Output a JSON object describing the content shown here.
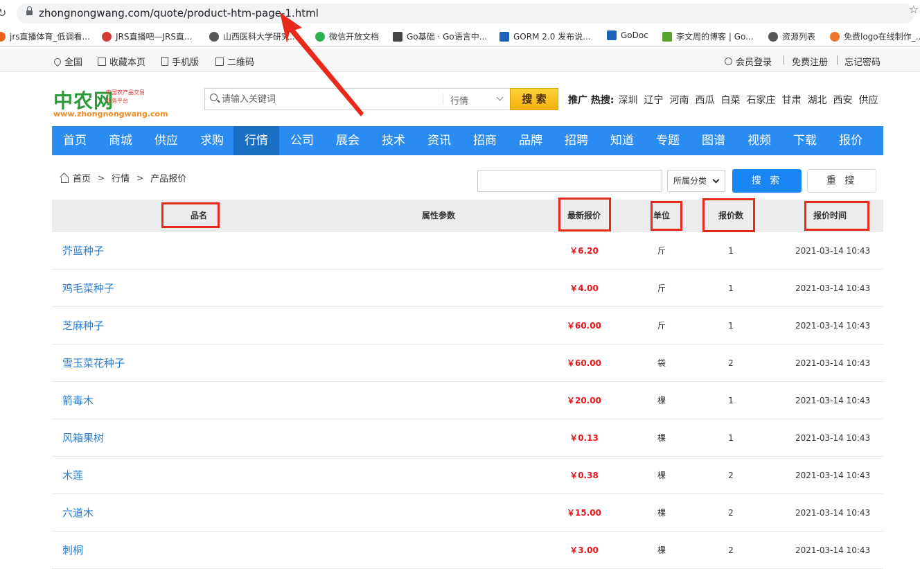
{
  "browser": {
    "url": "zhongnongwang.com/quote/product-htm-page-1.html",
    "bookmarks": [
      {
        "label": "jrs直播体育_低调看...",
        "color": "#e8631c"
      },
      {
        "label": "JRS直播吧—JRS直...",
        "color": "#d33a3a"
      },
      {
        "label": "山西医科大学研究...",
        "color": "#555555"
      },
      {
        "label": "微信开放文档",
        "color": "#2bb24c"
      },
      {
        "label": "Go基础 · Go语言中...",
        "color": "#444444"
      },
      {
        "label": "GORM 2.0 发布说...",
        "color": "#1d62b8"
      },
      {
        "label": "GoDoc",
        "color": "#1d62b8"
      },
      {
        "label": "李文周的博客 | Go...",
        "color": "#5aa52c"
      },
      {
        "label": "资源列表",
        "color": "#555555"
      },
      {
        "label": "免费logo在线制作_...",
        "color": "#f0732a"
      }
    ]
  },
  "topbar": {
    "location": "全国",
    "bookmark": "收藏本页",
    "mobile": "手机版",
    "qrcode": "二维码",
    "login": "会员登录",
    "register": "免费注册",
    "forgot": "忘记密码"
  },
  "header": {
    "logo_text": "中农网",
    "logo_domain": "www.zhongnongwang.com",
    "logo_slogan": "中国农产品交易服务平台",
    "search_placeholder": "请输入关键词",
    "search_category": "行情",
    "search_button": "搜 索",
    "hot_label": "推广 热搜:",
    "hot_words": [
      "深圳",
      "辽宁",
      "河南",
      "西瓜",
      "白菜",
      "石家庄",
      "甘肃",
      "湖北",
      "西安",
      "供应"
    ]
  },
  "nav": {
    "items": [
      "首页",
      "商城",
      "供应",
      "求购",
      "行情",
      "公司",
      "展会",
      "技术",
      "资讯",
      "招商",
      "品牌",
      "招聘",
      "知道",
      "专题",
      "图谱",
      "视频",
      "下载",
      "报价"
    ],
    "active": "行情"
  },
  "breadcrumb": [
    "首页",
    "行情",
    "产品报价"
  ],
  "filter": {
    "input_value": "",
    "select_value": "所属分类",
    "search_button": "搜 索",
    "reset_button": "重 搜"
  },
  "table": {
    "columns": [
      "品名",
      "属性参数",
      "最新报价",
      "单位",
      "报价数",
      "报价时间"
    ],
    "rows": [
      {
        "name": "芥蓝种子",
        "params": "",
        "price": "￥6.20",
        "unit": "斤",
        "count": "1",
        "time": "2021-03-14 10:43"
      },
      {
        "name": "鸡毛菜种子",
        "params": "",
        "price": "￥4.00",
        "unit": "斤",
        "count": "1",
        "time": "2021-03-14 10:43"
      },
      {
        "name": "芝麻种子",
        "params": "",
        "price": "￥60.00",
        "unit": "斤",
        "count": "1",
        "time": "2021-03-14 10:43"
      },
      {
        "name": "雪玉菜花种子",
        "params": "",
        "price": "￥60.00",
        "unit": "袋",
        "count": "2",
        "time": "2021-03-14 10:43"
      },
      {
        "name": "箭毒木",
        "params": "",
        "price": "￥20.00",
        "unit": "棵",
        "count": "1",
        "time": "2021-03-14 10:43"
      },
      {
        "name": "风箱果树",
        "params": "",
        "price": "￥0.13",
        "unit": "棵",
        "count": "1",
        "time": "2021-03-14 10:43"
      },
      {
        "name": "木莲",
        "params": "",
        "price": "￥0.38",
        "unit": "棵",
        "count": "2",
        "time": "2021-03-14 10:43"
      },
      {
        "name": "六道木",
        "params": "",
        "price": "￥15.00",
        "unit": "棵",
        "count": "2",
        "time": "2021-03-14 10:43"
      },
      {
        "name": "刺桐",
        "params": "",
        "price": "￥3.00",
        "unit": "棵",
        "count": "2",
        "time": "2021-03-14 10:43"
      }
    ]
  },
  "colors": {
    "nav_bg": "#2a8cf0",
    "nav_active": "#1a6fc4",
    "price_red": "#e5151a",
    "link_blue": "#2a7fd4",
    "annotation_red": "#e8291c"
  }
}
